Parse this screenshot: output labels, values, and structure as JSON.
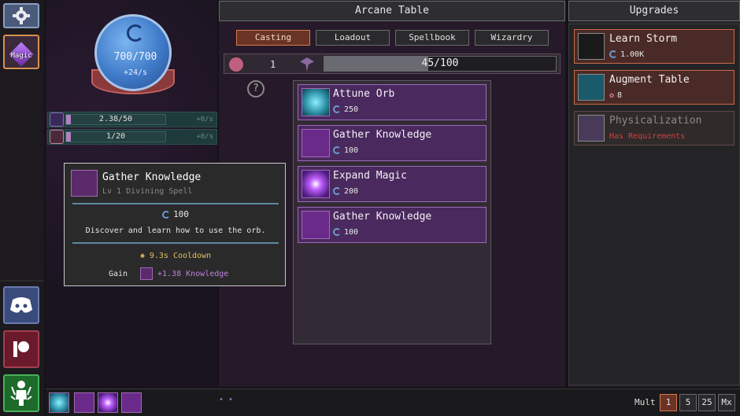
{
  "sidebar": {
    "settings_icon": "gear-puzzle-icon",
    "magic_label": "Magic",
    "discord_icon": "discord-icon",
    "patreon_icon": "patreon-icon",
    "avatar_icon": "person-aura-icon"
  },
  "mana": {
    "value": "700/700",
    "rate": "+24/s",
    "fill_fraction": 1.0
  },
  "resources": [
    {
      "name": "knowledge",
      "bar_text": "2.38/50",
      "rate": "+0/s",
      "fill_fraction": 0.048,
      "icon": "knowledge-rune-icon"
    },
    {
      "name": "essence",
      "bar_text": "1/20",
      "rate": "+0/s",
      "fill_fraction": 0.05,
      "icon": "essence-flower-icon"
    }
  ],
  "tooltip": {
    "title": "Gather Knowledge",
    "subtitle": "Lv 1 Divining Spell",
    "cost": "100",
    "description": "Discover and learn how to use the orb.",
    "cooldown": "9.3s Cooldown",
    "gain_label": "Gain",
    "gain_value": "+1.38 Knowledge"
  },
  "center": {
    "title": "Arcane Table",
    "tabs": [
      "Casting",
      "Loadout",
      "Spellbook",
      "Wizardry"
    ],
    "active_tab": "Casting",
    "stat_count": "1",
    "progress_text": "45/100",
    "progress_fraction": 0.45,
    "help_symbol": "?",
    "spells": [
      {
        "name": "Attune Orb",
        "cost": "250",
        "icon": "orb-burst-icon",
        "color": "#2a8aa0"
      },
      {
        "name": "Gather Knowledge",
        "cost": "100",
        "icon": "knowledge-rune-icon",
        "color": "#6a2a8a"
      },
      {
        "name": "Expand Magic",
        "cost": "200",
        "icon": "magic-star-icon",
        "color": "#4a1a7a"
      },
      {
        "name": "Gather Knowledge",
        "cost": "100",
        "icon": "knowledge-rune-icon",
        "color": "#6a2a8a"
      }
    ]
  },
  "upgrades": {
    "title": "Upgrades",
    "items": [
      {
        "name": "Learn Storm",
        "cost": "1.00K",
        "cost_icon": "mana-swirl-icon",
        "icon": "storm-rune-icon",
        "state": "available"
      },
      {
        "name": "Augment Table",
        "cost": "8",
        "cost_icon": "essence-flower-icon",
        "icon": "table-tablet-icon",
        "state": "available"
      },
      {
        "name": "Physicalization",
        "cost": "Has Requirements",
        "icon": "spellbook-icon",
        "state": "locked"
      }
    ]
  },
  "bottombar": {
    "quickslots": [
      "orb-burst-icon",
      "knowledge-rune-icon",
      "magic-star-icon",
      "knowledge-rune-icon"
    ],
    "dots": "• •",
    "mult_label": "Mult",
    "mult_options": [
      "1",
      "5",
      "25",
      "Mx"
    ],
    "active_mult": "1"
  },
  "colors": {
    "accent_active": "#d87850",
    "spell_bg": "#4a2a5e",
    "locked_text": "#d04040",
    "mana": "#3f7ac8"
  }
}
